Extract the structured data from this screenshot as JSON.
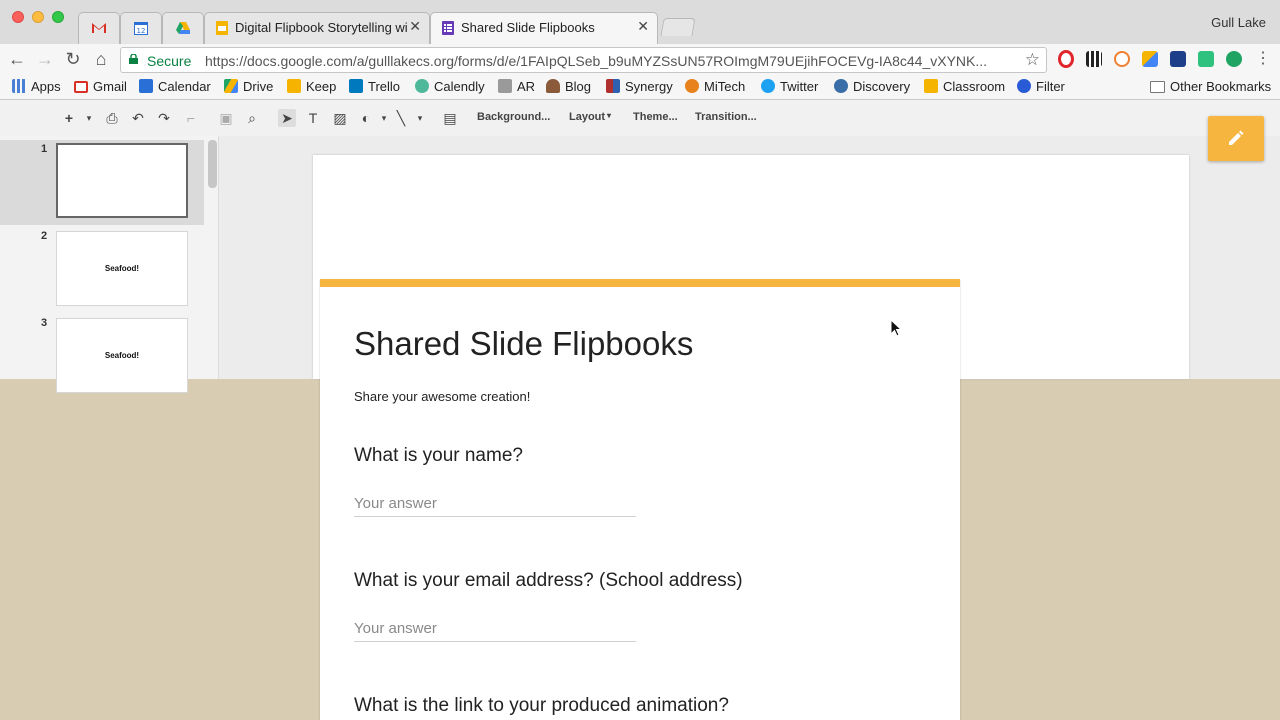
{
  "browser": {
    "tabs": [
      {
        "title": "",
        "favicon": "gmail-icon"
      },
      {
        "title": "",
        "favicon": "calendar-icon"
      },
      {
        "title": "",
        "favicon": "drive-icon"
      },
      {
        "title": "Digital Flipbook Storytelling wi",
        "favicon": "slides-icon"
      },
      {
        "title": "Shared Slide Flipbooks",
        "favicon": "forms-icon"
      }
    ],
    "profile_name": "Gull Lake",
    "address": {
      "secure_label": "Secure",
      "url": "https://docs.google.com/a/gulllakecs.org/forms/d/e/1FAIpQLSeb_b9uMYZSsUN57ROImgM79UEjihFOCEVg-IA8c44_vXYNK..."
    }
  },
  "bookmarks": [
    {
      "label": "Apps",
      "icon": "apps-grid-icon",
      "color": "#4a7fd6"
    },
    {
      "label": "Gmail",
      "icon": "gmail-icon",
      "color": "#d93025"
    },
    {
      "label": "Calendar",
      "icon": "calendar-icon",
      "color": "#2a6fd6"
    },
    {
      "label": "Drive",
      "icon": "drive-icon",
      "color": "#1fa463"
    },
    {
      "label": "Keep",
      "icon": "keep-icon",
      "color": "#f6b400"
    },
    {
      "label": "Trello",
      "icon": "trello-icon",
      "color": "#0079bf"
    },
    {
      "label": "Calendly",
      "icon": "calendly-icon",
      "color": "#4fb89a"
    },
    {
      "label": "AR",
      "icon": "ar-icon",
      "color": "#7a7a7a"
    },
    {
      "label": "Blog",
      "icon": "blog-icon",
      "color": "#8a5a3a"
    },
    {
      "label": "Synergy",
      "icon": "synergy-icon",
      "color": "#b03030"
    },
    {
      "label": "MiTech",
      "icon": "mitech-icon",
      "color": "#e8821c"
    },
    {
      "label": "Twitter",
      "icon": "twitter-icon",
      "color": "#1da1f2"
    },
    {
      "label": "Discovery",
      "icon": "discovery-icon",
      "color": "#3a6ea8"
    },
    {
      "label": "Classroom",
      "icon": "classroom-icon",
      "color": "#f4b400"
    },
    {
      "label": "Filter",
      "icon": "filter-icon",
      "color": "#2a5bd6"
    }
  ],
  "other_bookmarks": "Other Bookmarks",
  "slides_editor": {
    "toolbar": {
      "background": "Background...",
      "layout": "Layout",
      "theme": "Theme...",
      "transition": "Transition..."
    },
    "slides": [
      {
        "number": "1",
        "text": ""
      },
      {
        "number": "2",
        "text": "Seafood!"
      },
      {
        "number": "3",
        "text": "Seafood!"
      }
    ]
  },
  "form": {
    "title": "Shared Slide Flipbooks",
    "description": "Share your awesome creation!",
    "accent_color": "#f6b53f",
    "questions": [
      {
        "title": "What is your name?",
        "placeholder": "Your answer"
      },
      {
        "title": "What is your email address? (School address)",
        "placeholder": "Your answer"
      },
      {
        "title": "What is the link to your produced animation?",
        "placeholder": "Your answer"
      }
    ]
  }
}
